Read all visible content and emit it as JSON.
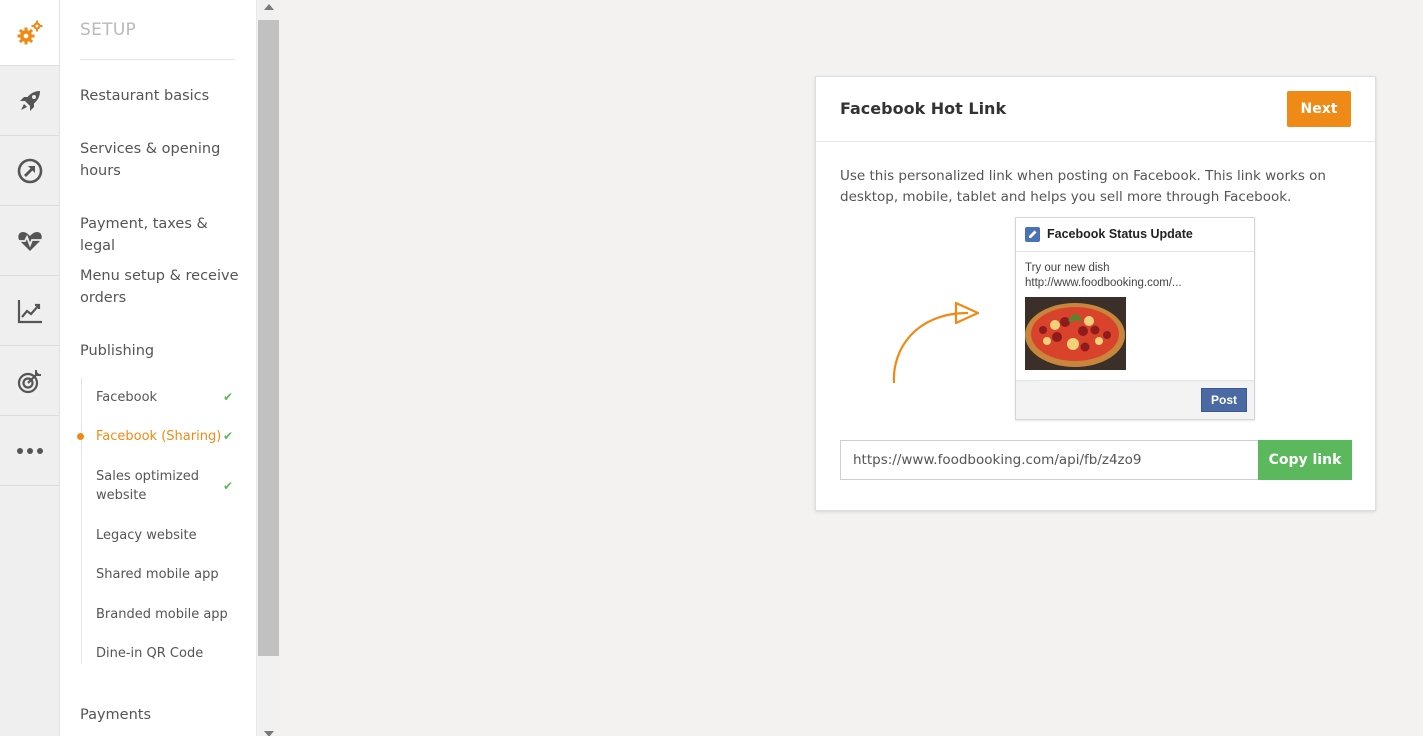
{
  "rail": {
    "items": [
      {
        "icon": "gears-icon",
        "active": true
      },
      {
        "icon": "rocket-icon"
      },
      {
        "icon": "compass-arrow-icon"
      },
      {
        "icon": "heartbeat-icon"
      },
      {
        "icon": "line-chart-icon"
      },
      {
        "icon": "target-icon"
      },
      {
        "icon": "more-dots-icon"
      }
    ]
  },
  "sidebar": {
    "title": "SETUP",
    "items": [
      {
        "label": "Restaurant basics"
      },
      {
        "label": "Services & opening hours"
      },
      {
        "label": "Payment, taxes & legal"
      },
      {
        "label": "Menu setup & receive orders"
      },
      {
        "label": "Publishing"
      },
      {
        "label": "Payments"
      }
    ],
    "publishing_items": [
      {
        "label": "Facebook",
        "done": true
      },
      {
        "label": "Facebook (Sharing)",
        "done": true,
        "current": true
      },
      {
        "label": "Sales optimized website",
        "done": true
      },
      {
        "label": "Legacy website",
        "done": false
      },
      {
        "label": "Shared mobile app",
        "done": false
      },
      {
        "label": "Branded mobile app",
        "done": false
      },
      {
        "label": "Dine-in QR Code",
        "done": false
      }
    ],
    "check_glyph": "✔"
  },
  "card": {
    "title": "Facebook Hot Link",
    "next_label": "Next",
    "description": "Use this personalized link when posting on Facebook. This link works on desktop, mobile, tablet and helps you sell more through Facebook.",
    "fb_preview": {
      "title": "Facebook Status Update",
      "line1": "Try our new dish",
      "line2": "http://www.foodbooking.com/...",
      "post_label": "Post"
    },
    "link_value": "https://www.foodbooking.com/api/fb/z4zo9",
    "copy_label": "Copy link"
  },
  "colors": {
    "accent": "#f08a16",
    "success": "#5cb85c",
    "facebook": "#4b6aa3",
    "background": "#f3f2f0"
  }
}
